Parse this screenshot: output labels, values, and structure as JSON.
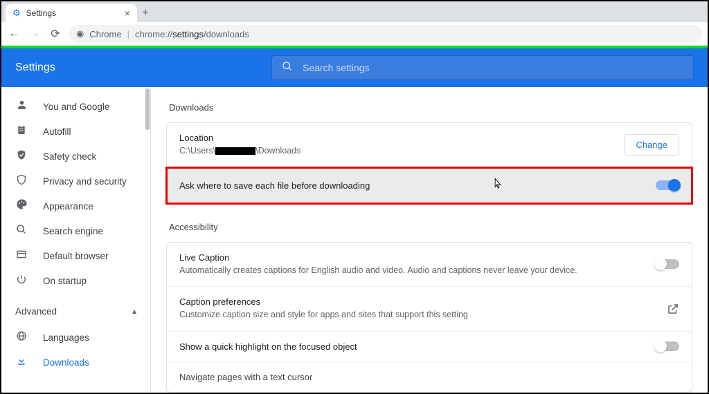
{
  "browser": {
    "tab_title": "Settings",
    "address_prefix": "Chrome",
    "address_path_pre": "chrome://",
    "address_path_bold": "settings",
    "address_path_post": "/downloads"
  },
  "header": {
    "title": "Settings",
    "search_placeholder": "Search settings"
  },
  "sidebar": {
    "items": [
      {
        "icon": "person",
        "label": "You and Google"
      },
      {
        "icon": "clipboard",
        "label": "Autofill"
      },
      {
        "icon": "shield-check",
        "label": "Safety check"
      },
      {
        "icon": "shield",
        "label": "Privacy and security"
      },
      {
        "icon": "palette",
        "label": "Appearance"
      },
      {
        "icon": "search",
        "label": "Search engine"
      },
      {
        "icon": "browser",
        "label": "Default browser"
      },
      {
        "icon": "power",
        "label": "On startup"
      }
    ],
    "advanced_label": "Advanced",
    "advanced_items": [
      {
        "icon": "globe",
        "label": "Languages"
      },
      {
        "icon": "download",
        "label": "Downloads",
        "active": true
      }
    ]
  },
  "main": {
    "downloads": {
      "title": "Downloads",
      "location_label": "Location",
      "location_prefix": "C:\\Users\\",
      "location_suffix": "\\Downloads",
      "change_btn": "Change",
      "ask_label": "Ask where to save each file before downloading"
    },
    "accessibility": {
      "title": "Accessibility",
      "live_caption_label": "Live Caption",
      "live_caption_sub": "Automatically creates captions for English audio and video. Audio and captions never leave your device.",
      "caption_pref_label": "Caption preferences",
      "caption_pref_sub": "Customize caption size and style for apps and sites that support this setting",
      "quick_highlight_label": "Show a quick highlight on the focused object",
      "nav_text_cursor_label": "Navigate pages with a text cursor"
    }
  }
}
